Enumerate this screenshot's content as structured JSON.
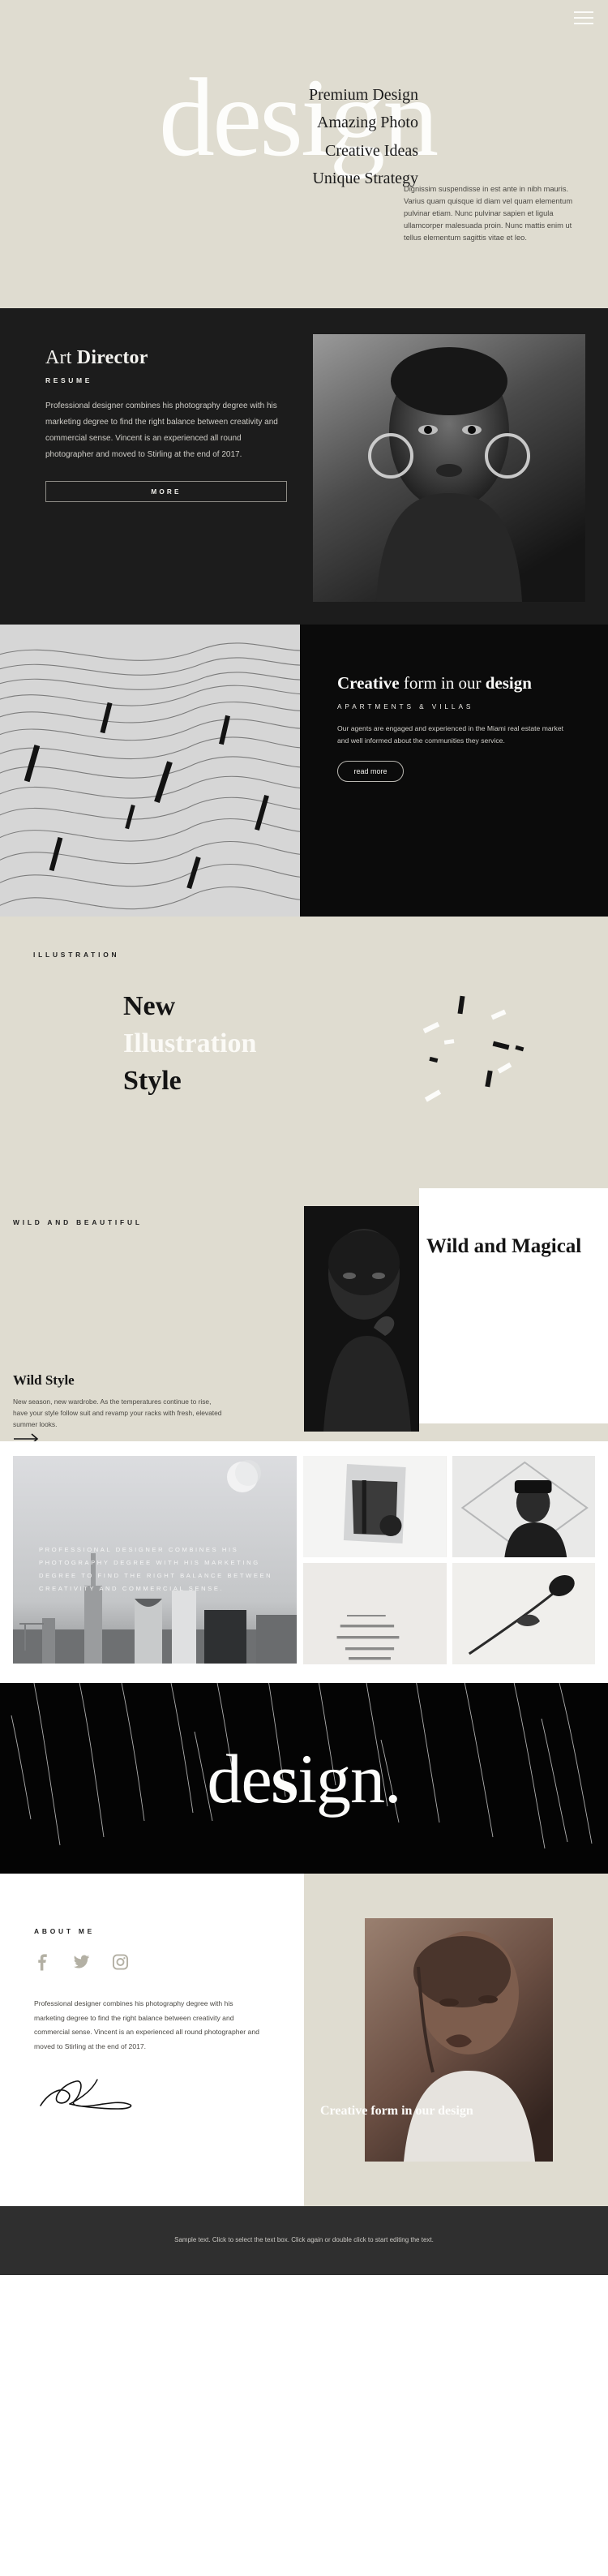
{
  "hero": {
    "menu_icon": "hamburger-icon",
    "big_word": "design",
    "lines": [
      "Premium Design",
      "Amazing Photo",
      "Creative Ideas",
      "Unique Strategy"
    ],
    "paragraph": "Dignissim suspendisse in est ante in nibh mauris. Varius quam quisque id diam vel quam elementum pulvinar etiam. Nunc pulvinar sapien et ligula ullamcorper malesuada proin. Nunc mattis enim ut tellus elementum sagittis vitae et leo."
  },
  "resume": {
    "title_light": "Art ",
    "title_bold": "Director",
    "kicker": "RESUME",
    "paragraph": "Professional designer combines his photography degree with his marketing degree to find the right balance between creativity and commercial sense. Vincent is an experienced all round photographer and moved to Stirling at the end of 2017.",
    "button_label": "MORE"
  },
  "creative": {
    "title_bold_1": "Creative",
    "title_light": " form in our ",
    "title_bold_2": "design",
    "kicker": "APARTMENTS  &  VILLAS",
    "paragraph": "Our agents are engaged and experienced in the Miami real estate market and well informed about the communities they service.",
    "button_label": "read more"
  },
  "illustration": {
    "kicker": "ILLUSTRATION",
    "line1": "New",
    "line2": "Illustration",
    "line3": "Style"
  },
  "wild": {
    "kicker": "WILD AND BEAUTIFUL",
    "big_title": "Wild and Magical",
    "subtitle": "Wild Style",
    "paragraph": "New season, new wardrobe. As the temperatures continue to rise, have your style follow suit and revamp your racks with fresh, elevated summer looks.",
    "arrow_icon": "arrow-right-icon"
  },
  "gallery": {
    "overlay_text": "PROFESSIONAL DESIGNER COMBINES HIS PHOTOGRAPHY DEGREE WITH HIS MARKETING DEGREE TO FIND THE RIGHT BALANCE BETWEEN CREATIVITY AND COMMERCIAL SENSE."
  },
  "banner": {
    "word_light": "de",
    "word_bold": "s",
    "word_rest": "ign."
  },
  "about": {
    "kicker": "ABOUT ME",
    "socials": [
      {
        "name": "facebook-icon"
      },
      {
        "name": "twitter-icon"
      },
      {
        "name": "instagram-icon"
      }
    ],
    "paragraph": "Professional designer combines his photography degree with his marketing degree to find the right balance between creativity and commercial sense. Vincent is an experienced all round photographer and moved to Stirling at the end of 2017.",
    "signature": "signature-mark",
    "photo_caption": "Creative form in our design"
  },
  "footer": {
    "text": "Sample text. Click to select the text box. Click again or double click to start editing the text."
  },
  "colors": {
    "beige": "#dfdcd0",
    "dark": "#1c1c1c",
    "near_black": "#0b0b0b",
    "footer": "#2f2f2f",
    "cream_text": "#fdfdfb"
  }
}
